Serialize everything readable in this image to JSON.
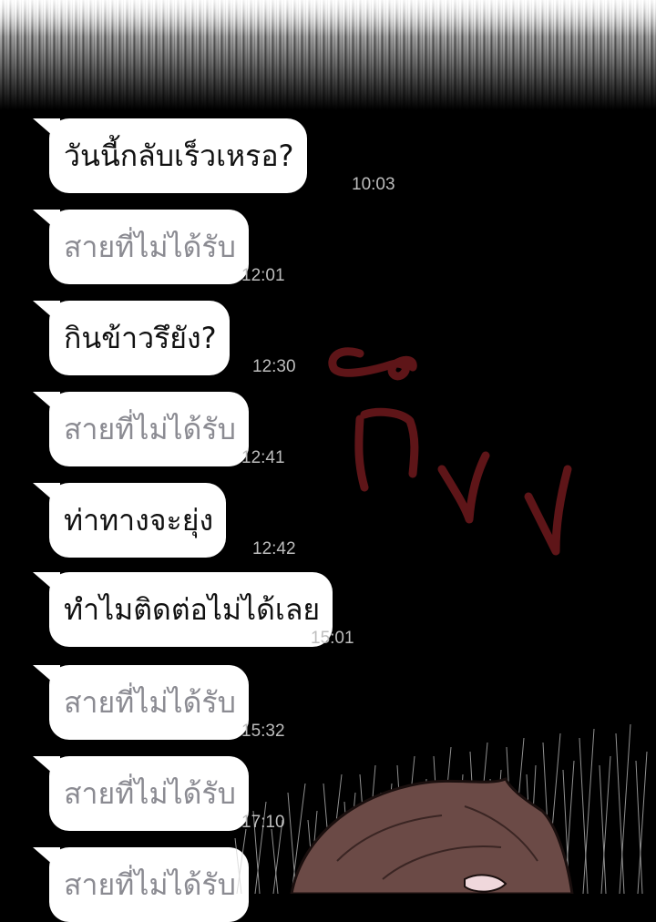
{
  "messages": [
    {
      "text": "วันนี้กลับเร็วเหรอ?",
      "time": "10:03",
      "missed": false
    },
    {
      "text": "สายที่ไม่ได้รับ",
      "time": "12:01",
      "missed": true
    },
    {
      "text": "กินข้าวรึยัง?",
      "time": "12:30",
      "missed": false
    },
    {
      "text": "สายที่ไม่ได้รับ",
      "time": "12:41",
      "missed": true
    },
    {
      "text": "ท่าทางจะยุ่ง",
      "time": "12:42",
      "missed": false
    },
    {
      "text": "ทำไมติดต่อไม่ได้เลย",
      "time": "15:01",
      "missed": false
    },
    {
      "text": "สายที่ไม่ได้รับ",
      "time": "15:32",
      "missed": true
    },
    {
      "text": "สายที่ไม่ได้รับ",
      "time": "17:10",
      "missed": true
    },
    {
      "text": "สายที่ไม่ได้รับ",
      "time": "",
      "missed": true
    }
  ],
  "sound_effect_text": "ตึง",
  "colors": {
    "background": "#000000",
    "bubble": "#ffffff",
    "missed_text": "#8b8b92",
    "sfx": "#5e1518",
    "hair": "#6b4a46"
  }
}
